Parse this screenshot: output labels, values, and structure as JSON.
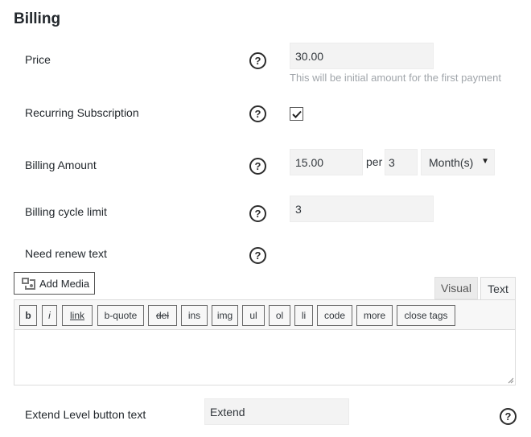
{
  "section": {
    "title": "Billing"
  },
  "price": {
    "label": "Price",
    "value": "30.00",
    "hint": "This will be initial amount for the first payment"
  },
  "recurring": {
    "label": "Recurring Subscription",
    "checked": true
  },
  "billing_amount": {
    "label": "Billing Amount",
    "value": "15.00",
    "per_label": "per",
    "period_count": "3",
    "period_unit": "Month(s)"
  },
  "cycle_limit": {
    "label": "Billing cycle limit",
    "value": "3"
  },
  "renew_text": {
    "label": "Need renew text"
  },
  "editor": {
    "add_media_label": "Add Media",
    "tabs": {
      "visual": "Visual",
      "text": "Text"
    },
    "buttons": {
      "b": "b",
      "i": "i",
      "link": "link",
      "bquote": "b-quote",
      "del": "del",
      "ins": "ins",
      "img": "img",
      "ul": "ul",
      "ol": "ol",
      "li": "li",
      "code": "code",
      "more": "more",
      "close": "close tags"
    }
  },
  "extend": {
    "label": "Extend Level button text",
    "value": "Extend"
  },
  "help_glyph": "?"
}
